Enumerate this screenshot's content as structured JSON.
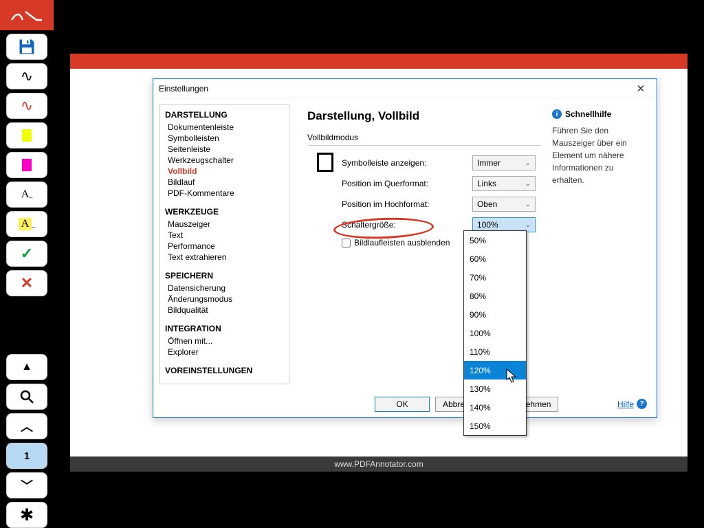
{
  "footer": {
    "url": "www.PDFAnnotator.com"
  },
  "toolbar": {
    "items": [
      {
        "name": "app-icon"
      },
      {
        "name": "save-icon"
      },
      {
        "name": "pen-black-icon"
      },
      {
        "name": "pen-red-icon"
      },
      {
        "name": "highlighter-yellow-icon"
      },
      {
        "name": "highlighter-magenta-icon"
      },
      {
        "name": "text-white-icon",
        "glyph": "A"
      },
      {
        "name": "text-yellow-icon",
        "glyph": "A"
      },
      {
        "name": "check-icon"
      },
      {
        "name": "x-icon"
      }
    ],
    "bottom_items": [
      {
        "name": "collapse-up-icon"
      },
      {
        "name": "zoom-icon"
      },
      {
        "name": "prev-page-icon"
      },
      {
        "name": "page-indicator",
        "label": "1"
      },
      {
        "name": "next-page-icon"
      },
      {
        "name": "settings-icon"
      }
    ]
  },
  "dialog": {
    "title": "Einstellungen",
    "sidebar": {
      "groups": [
        {
          "title": "DARSTELLUNG",
          "items": [
            "Dokumentenleiste",
            "Symbolleisten",
            "Seitenleiste",
            "Werkzeugschalter",
            "Vollbild",
            "Bildlauf",
            "PDF-Kommentare"
          ],
          "active": "Vollbild"
        },
        {
          "title": "WERKZEUGE",
          "items": [
            "Mauszeiger",
            "Text",
            "Performance",
            "Text extrahieren"
          ]
        },
        {
          "title": "SPEICHERN",
          "items": [
            "Datensicherung",
            "Änderungsmodus",
            "Bildqualität"
          ]
        },
        {
          "title": "INTEGRATION",
          "items": [
            "Öffnen mit...",
            "Explorer"
          ]
        },
        {
          "title": "VOREINSTELLUNGEN",
          "items": []
        }
      ]
    },
    "content": {
      "heading": "Darstellung, Vollbild",
      "section_label": "Vollbildmodus",
      "rows": [
        {
          "label": "Symbolleiste anzeigen:",
          "value": "Immer"
        },
        {
          "label": "Position im Querformat:",
          "value": "Links"
        },
        {
          "label": "Position im Hochformat:",
          "value": "Oben"
        },
        {
          "label": "Schaltergröße:",
          "value": "100%",
          "highlight": true,
          "open": true
        }
      ],
      "checkbox": {
        "label": "Bildlaufleisten ausblenden",
        "checked": false
      }
    },
    "dropdown_options": [
      "50%",
      "60%",
      "70%",
      "80%",
      "90%",
      "100%",
      "110%",
      "120%",
      "130%",
      "140%",
      "150%"
    ],
    "dropdown_hover": "120%",
    "help": {
      "title": "Schnellhilfe",
      "text": "Führen Sie den Mauszeiger über ein Element um nähere Informationen zu erhalten."
    },
    "buttons": {
      "ok": "OK",
      "cancel": "Abbrechen",
      "apply": "Übernehmen",
      "help": "Hilfe"
    }
  }
}
